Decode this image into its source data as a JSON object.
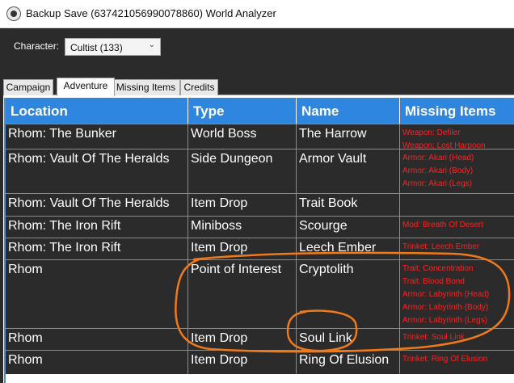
{
  "window": {
    "title": "Backup Save (637421056990078860) World Analyzer",
    "icon": "app-icon"
  },
  "character": {
    "label": "Character:",
    "selected": "Cultist (133)"
  },
  "tabs": [
    {
      "label": "Campaign",
      "active": false
    },
    {
      "label": "Adventure",
      "active": true
    },
    {
      "label": "Missing Items",
      "active": false
    },
    {
      "label": "Credits",
      "active": false
    }
  ],
  "grid": {
    "headers": {
      "location": "Location",
      "type": "Type",
      "name": "Name",
      "missing": "Missing Items"
    },
    "rows": [
      {
        "location": "Rhom: The Bunker",
        "type": "World Boss",
        "name": "The Harrow",
        "missing": [
          "Weapon: Defiler",
          "Weapon: Lost Harpoon"
        ]
      },
      {
        "location": "Rhom: Vault Of The Heralds",
        "type": "Side Dungeon",
        "name": "Armor Vault",
        "missing": [
          "Armor: Akari (Head)",
          "Armor: Akari (Body)",
          "Armor: Akari (Legs)"
        ]
      },
      {
        "location": "Rhom: Vault Of The Heralds",
        "type": "Item Drop",
        "name": "Trait Book",
        "missing": []
      },
      {
        "location": "Rhom: The Iron Rift",
        "type": "Miniboss",
        "name": "Scourge",
        "missing": [
          "Mod: Breath Of Desert"
        ]
      },
      {
        "location": "Rhom: The Iron Rift",
        "type": "Item Drop",
        "name": "Leech Ember",
        "missing": [
          "Trinket: Leech Ember"
        ]
      },
      {
        "location": "Rhom",
        "type": "Point of Interest",
        "name": "Cryptolith",
        "missing": [
          "Trait: Concentration",
          "Trait: Blood Bond",
          "Armor: Labyrinth (Head)",
          "Armor: Labyrinth (Body)",
          "Armor: Labyrinth (Legs)"
        ]
      },
      {
        "location": "Rhom",
        "type": "Item Drop",
        "name": "Soul Link",
        "missing": [
          "Trinket: Soul Link"
        ]
      },
      {
        "location": "Rhom",
        "type": "Item Drop",
        "name": "Ring Of Elusion",
        "missing": [
          "Trinket: Ring Of Elusion"
        ]
      }
    ]
  },
  "colors": {
    "header": "#2e86de",
    "row_bg": "#2b2b2b",
    "missing_text": "#ff2020",
    "annotation": "#f07a1a"
  }
}
